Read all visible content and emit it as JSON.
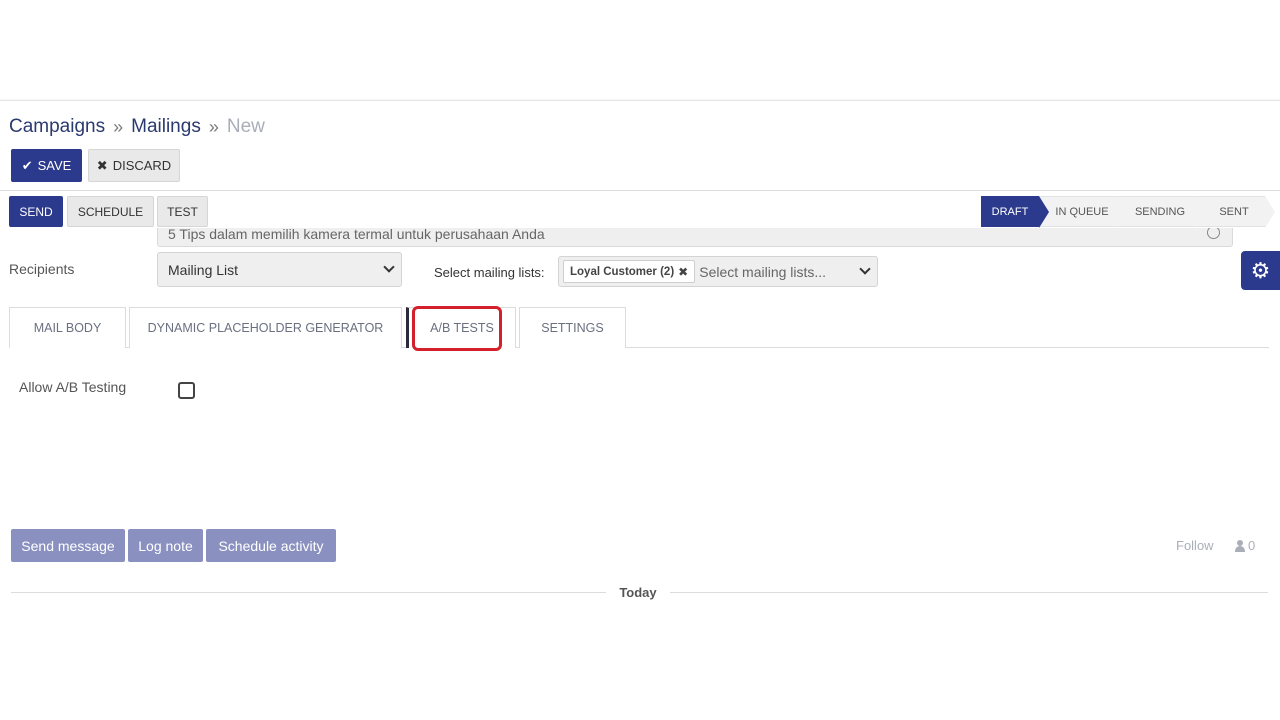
{
  "breadcrumb": {
    "items": [
      "Campaigns",
      "Mailings"
    ],
    "current": "New",
    "separator": "»"
  },
  "toolbar": {
    "save_label": "SAVE",
    "discard_label": "DISCARD"
  },
  "actions": {
    "send": "SEND",
    "schedule": "SCHEDULE",
    "test": "TEST"
  },
  "status_pipeline": {
    "stages": [
      "DRAFT",
      "IN QUEUE",
      "SENDING",
      "SENT"
    ],
    "active": "DRAFT"
  },
  "form": {
    "subject_value": "5 Tips dalam memilih kamera termal untuk perusahaan Anda",
    "recipients_label": "Recipients",
    "recipients_value": "Mailing List",
    "mailing_lists_label": "Select mailing lists:",
    "mailing_lists_tag": "Loyal Customer (2)",
    "mailing_lists_placeholder": "Select mailing lists..."
  },
  "tabs": [
    {
      "label": "MAIL BODY"
    },
    {
      "label": "DYNAMIC PLACEHOLDER GENERATOR"
    },
    {
      "label": "A/B TESTS",
      "active": true
    },
    {
      "label": "SETTINGS"
    }
  ],
  "ab_tests": {
    "allow_label": "Allow A/B Testing",
    "allow_checked": false
  },
  "chatter": {
    "send_message": "Send message",
    "log_note": "Log note",
    "schedule_activity": "Schedule activity",
    "follow": "Follow",
    "followers_count": "0",
    "today": "Today"
  },
  "colors": {
    "primary": "#2b3a8c",
    "chatter_button": "#8a91c0",
    "highlight": "#d4202a"
  },
  "icons": {
    "save": "check-icon",
    "discard": "close-icon",
    "settings": "gear-icon",
    "followers": "user-icon"
  }
}
